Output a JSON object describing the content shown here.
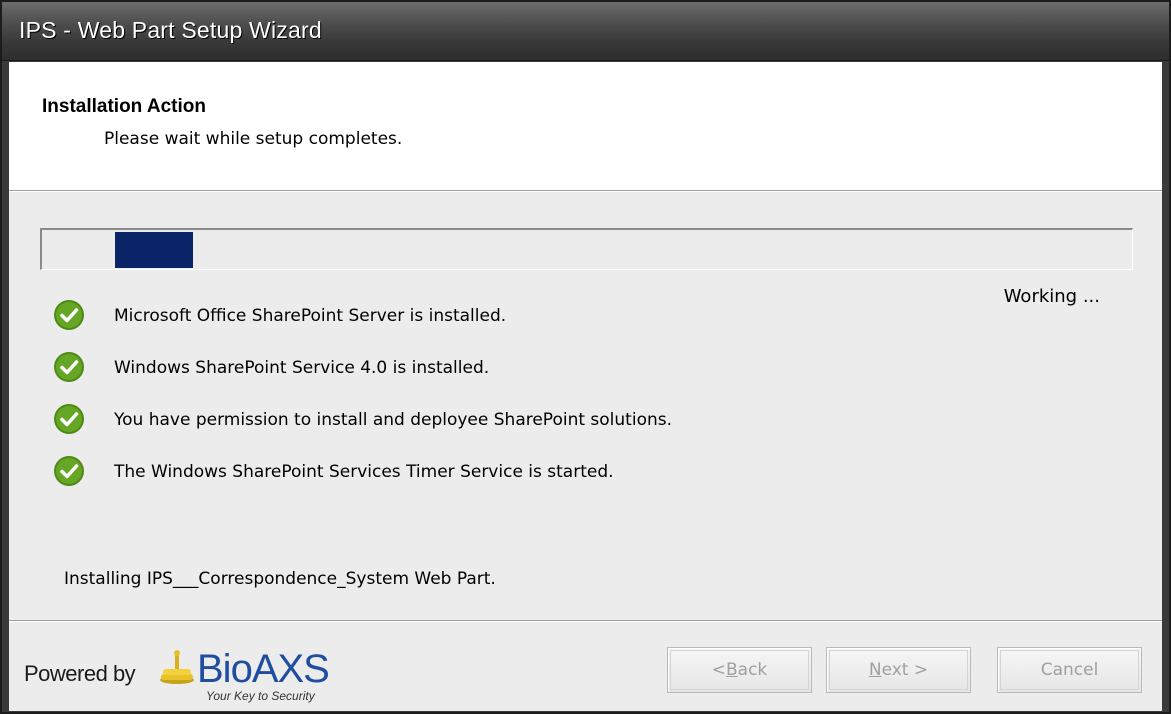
{
  "window": {
    "title": "IPS - Web Part Setup Wizard"
  },
  "header": {
    "title": "Installation Action",
    "subtitle": "Please wait while setup completes."
  },
  "progress": {
    "mode": "indeterminate-marquee",
    "status_label": "Working ..."
  },
  "checks": [
    {
      "icon": "green-check-icon",
      "label": "Microsoft Office SharePoint Server is installed."
    },
    {
      "icon": "green-check-icon",
      "label": "Windows SharePoint Service 4.0 is installed."
    },
    {
      "icon": "green-check-icon",
      "label": "You have permission to install and deployee SharePoint solutions."
    },
    {
      "icon": "green-check-icon",
      "label": "The Windows SharePoint Services Timer Service is started."
    }
  ],
  "status_line": "Installing IPS___Correspondence_System Web Part.",
  "footer": {
    "powered_by": "Powered by",
    "logo_text": "BioAXS",
    "logo_tagline": "Your Key to Security",
    "back_prefix": "< ",
    "back_mnemonic": "B",
    "back_rest": "ack",
    "next_mnemonic": "N",
    "next_rest": "ext >",
    "cancel_label": "Cancel"
  },
  "colors": {
    "progress_fill": "#0b2468",
    "check_green": "#5a9a1b",
    "logo_blue": "#1f4ea1"
  }
}
